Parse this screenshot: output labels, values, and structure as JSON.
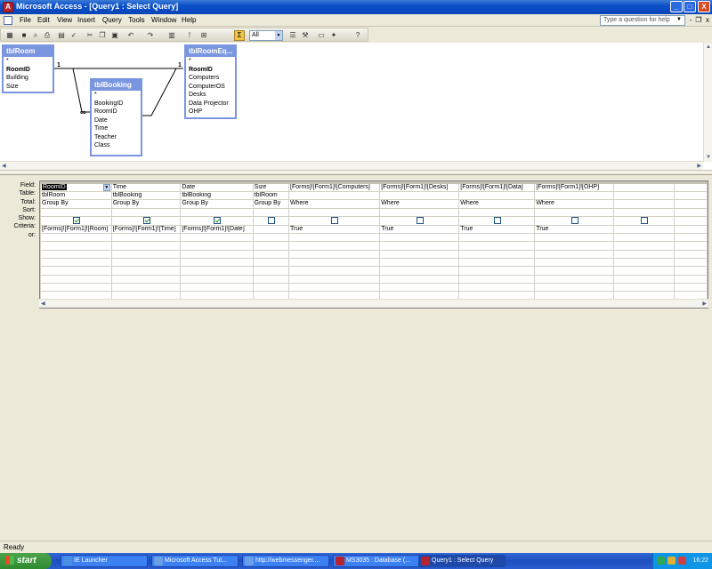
{
  "window": {
    "title": "Microsoft Access - [Query1 : Select Query]",
    "buttons": {
      "minimize": "_",
      "maximize": "□",
      "close": "X"
    }
  },
  "menu": {
    "items": [
      "File",
      "Edit",
      "View",
      "Insert",
      "Query",
      "Tools",
      "Window",
      "Help"
    ],
    "help_placeholder": "Type a question for help",
    "doc_buttons": {
      "minimize": "-",
      "restore": "❐",
      "close": "x"
    }
  },
  "toolbar": {
    "top_values": "All",
    "sigma_label": "Σ",
    "icons": [
      "view-icon",
      "save-icon",
      "search-icon",
      "print-icon",
      "print-preview-icon",
      "spelling-icon",
      "cut-icon",
      "copy-icon",
      "paste-icon",
      "undo-icon",
      "redo-icon",
      "query-type-icon",
      "run-icon",
      "show-table-icon",
      "totals-icon",
      "properties-icon",
      "build-icon",
      "database-window-icon",
      "new-object-icon",
      "help-icon"
    ]
  },
  "tables": {
    "tblRoom": {
      "title": "tblRoom",
      "fields": [
        "*",
        "RoomID",
        "Building",
        "Size"
      ],
      "key": "RoomID"
    },
    "tblBooking": {
      "title": "tblBooking",
      "fields": [
        "*",
        "BookingID",
        "RoomID",
        "Date",
        "Time",
        "Teacher",
        "Class"
      ],
      "key": "BookingID"
    },
    "tblRoomEq": {
      "title": "tblRoomEq...",
      "fields": [
        "*",
        "RoomID",
        "Computers",
        "ComputerOS",
        "Desks",
        "Data Projector",
        "OHP"
      ],
      "key": "RoomID"
    },
    "relationships": {
      "one_label": "1",
      "many_label": "∞"
    }
  },
  "grid": {
    "row_labels": [
      "Field:",
      "Table:",
      "Total:",
      "Sort:",
      "Show:",
      "Criteria:",
      "or:"
    ],
    "columns": [
      {
        "field": "RoomID",
        "table": "tblRoom",
        "total": "Group By",
        "sort": "",
        "show": true,
        "criteria": "[Forms]![Form1]![Room]",
        "or": ""
      },
      {
        "field": "Time",
        "table": "tblBooking",
        "total": "Group By",
        "sort": "",
        "show": true,
        "criteria": "[Forms]![Form1]![Time]",
        "or": ""
      },
      {
        "field": "Date",
        "table": "tblBooking",
        "total": "Group By",
        "sort": "",
        "show": true,
        "criteria": "[Forms]![Form1]![Date]",
        "or": ""
      },
      {
        "field": "Size",
        "table": "tblRoom",
        "total": "Group By",
        "sort": "",
        "show": false,
        "criteria": "",
        "or": ""
      },
      {
        "field": "[Forms]![Form1]![Computers]",
        "table": "",
        "total": "Where",
        "sort": "",
        "show": false,
        "criteria": "True",
        "or": ""
      },
      {
        "field": "[Forms]![Form1]![Desks]",
        "table": "",
        "total": "Where",
        "sort": "",
        "show": false,
        "criteria": "True",
        "or": ""
      },
      {
        "field": "[Forms]![Form1]![Data]",
        "table": "",
        "total": "Where",
        "sort": "",
        "show": false,
        "criteria": "True",
        "or": ""
      },
      {
        "field": "[Forms]![Form1]![OHP]",
        "table": "",
        "total": "Where",
        "sort": "",
        "show": false,
        "criteria": "True",
        "or": ""
      },
      {
        "field": "",
        "table": "",
        "total": "",
        "sort": "",
        "show": false,
        "criteria": "",
        "or": ""
      },
      {
        "field": "",
        "table": "",
        "total": "",
        "sort": "",
        "show": null,
        "criteria": "",
        "or": ""
      }
    ]
  },
  "status": {
    "text": "Ready"
  },
  "taskbar": {
    "start": "start",
    "tasks": [
      "IE Launcher",
      "Microsoft Access Tut...",
      "http://webmessenger....",
      "MS3035 : Database (...",
      "Query1 : Select Query"
    ],
    "clock": "16:22"
  }
}
